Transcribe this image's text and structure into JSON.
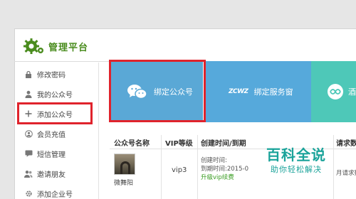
{
  "header": {
    "title": "管理平台"
  },
  "sidebar": {
    "items": [
      {
        "label": "修改密码",
        "icon": "lock-icon"
      },
      {
        "label": "我的公众号",
        "icon": "user-icon"
      },
      {
        "label": "添加公众号",
        "icon": "plus-icon"
      },
      {
        "label": "会员充值",
        "icon": "user-circle-icon"
      },
      {
        "label": "短信管理",
        "icon": "message-icon"
      },
      {
        "label": "邀请朋友",
        "icon": "users-icon"
      },
      {
        "label": "添加企业号",
        "icon": "gear-icon"
      }
    ]
  },
  "tiles": {
    "bind_account": "绑定公众号",
    "bind_service_brand": "ZCWZ",
    "bind_service": "绑定服务窗",
    "third_partial": "酒"
  },
  "table": {
    "headers": [
      "公众号名称",
      "VIP等级",
      "创建时间/到期",
      "请求数"
    ],
    "rows": [
      {
        "name": "微舞阳",
        "vip": "vip3",
        "created": "创建时间:",
        "expires": "到期时间:2015-0",
        "upgrade": "升级vip续费",
        "requests": "月请求数"
      }
    ]
  },
  "watermark": {
    "title": "百科全说",
    "subtitle": "助你轻松解决"
  },
  "colors": {
    "brand_green": "#4a8c1e",
    "tile_blue": "#5aa8d6",
    "tile_teal": "#4ec8b8",
    "highlight_red": "#e0232c"
  }
}
